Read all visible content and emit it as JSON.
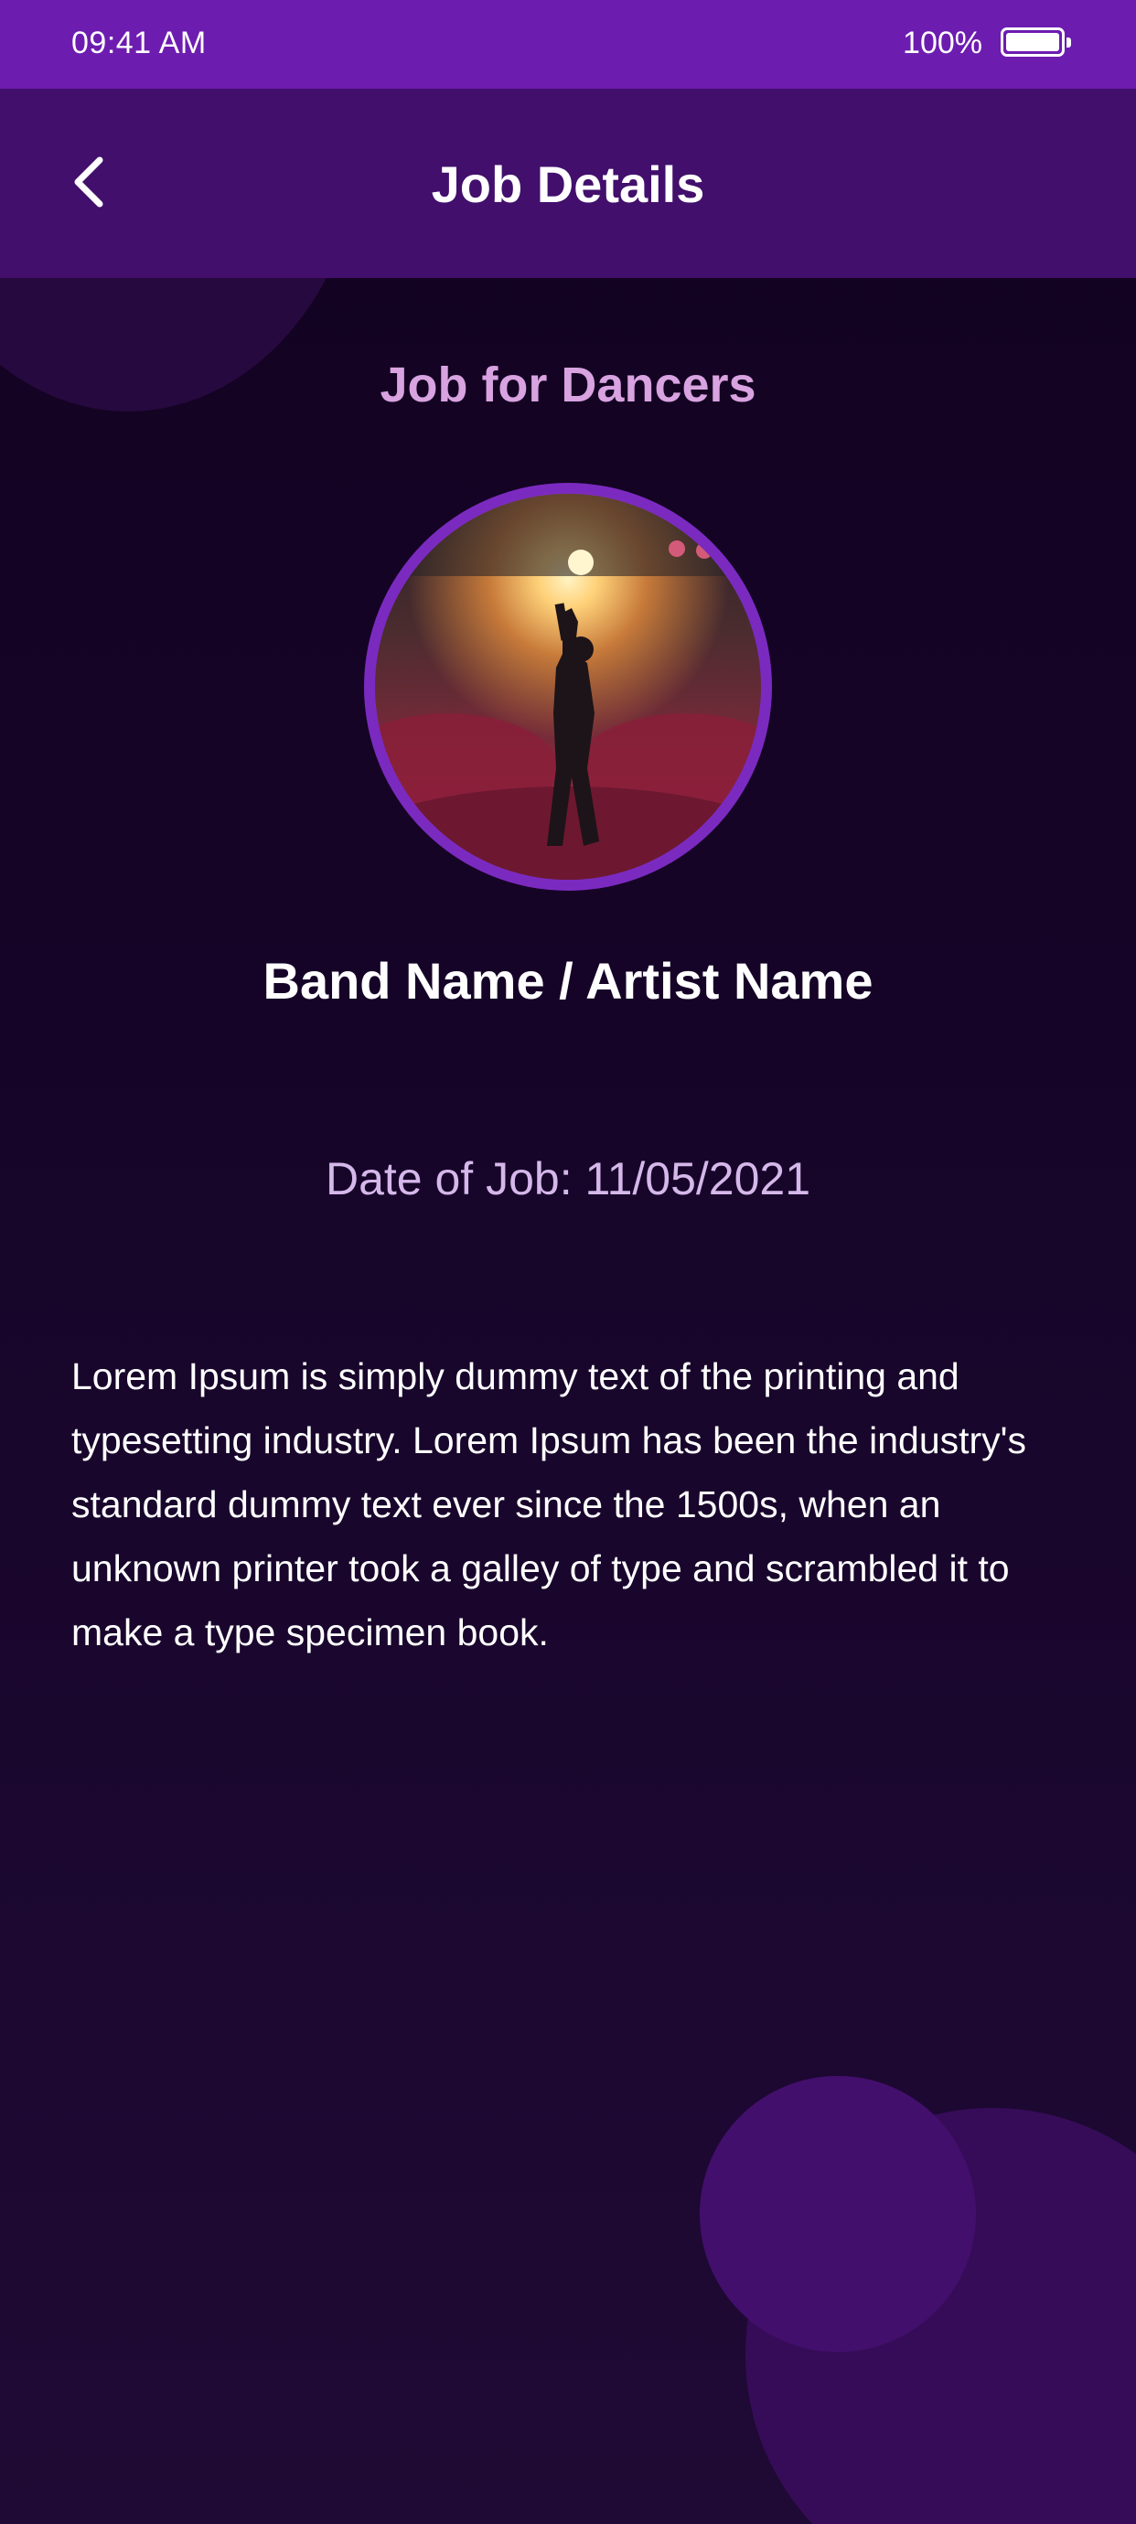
{
  "status_bar": {
    "time": "09:41 AM",
    "battery": "100%"
  },
  "header": {
    "title": "Job Details",
    "back_icon": "chevron-left-icon"
  },
  "job": {
    "category_title": "Job for Dancers",
    "artist_name": "Band Name / Artist Name",
    "date_line": "Date of Job: 11/05/2021",
    "description": "Lorem Ipsum is simply dummy text of the printing and typesetting industry. Lorem Ipsum has been the industry's standard dummy text ever since the 1500s, when an unknown printer took a galley of type and scrambled it to make a type specimen book."
  },
  "colors": {
    "status_bar": "#6d1cb0",
    "header": "#420f6c",
    "accent_ring": "#7b2ac0",
    "category_title": "#d8a3e0",
    "date_text": "#d5b8ea",
    "background": "#160428"
  }
}
